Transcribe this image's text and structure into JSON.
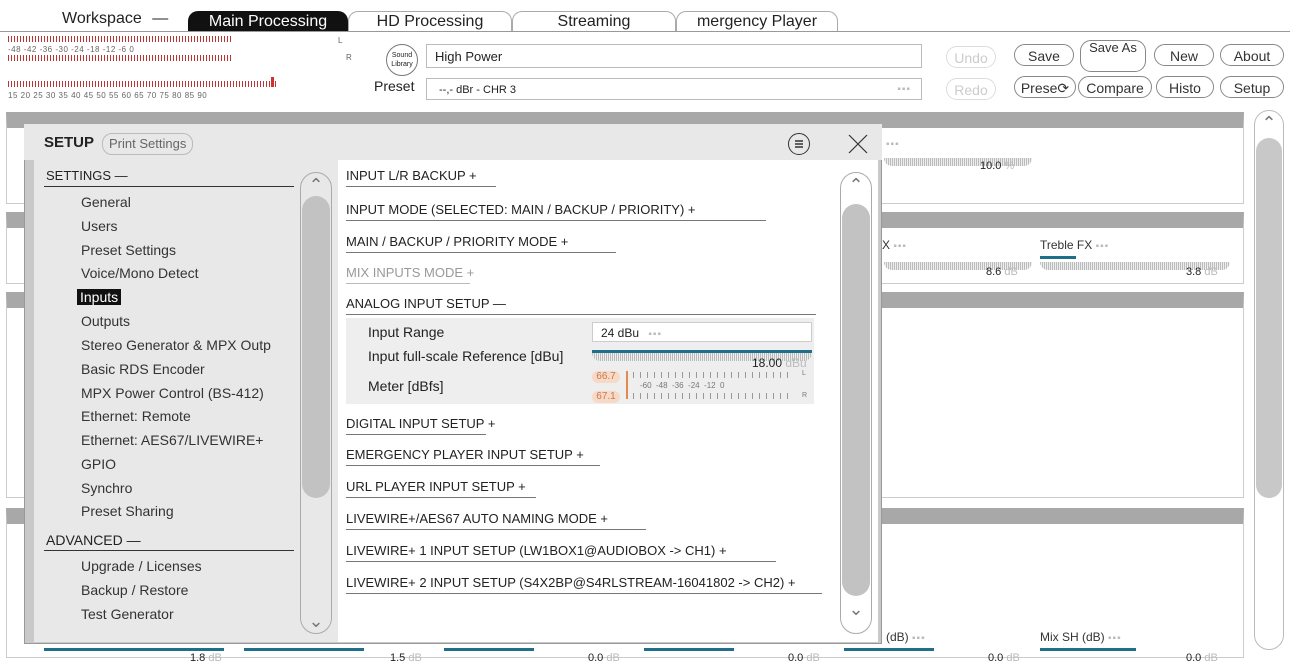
{
  "workspace": {
    "label": "Workspace"
  },
  "tabs": [
    {
      "label": "Main Processing"
    },
    {
      "label": "HD Processing"
    },
    {
      "label": "Streaming"
    },
    {
      "label": "mergency Player"
    }
  ],
  "meter": {
    "scale_top": "-48   -42   -36   -30   -24   -18    -12    -6     0",
    "l": "L",
    "r": "R",
    "scale_bottom": "15  20  25  30  35  40  45  50  55  60  65  70  75  80  85  90"
  },
  "sound_library": {
    "line1": "Sound",
    "line2": "Library"
  },
  "preset": {
    "name": "High Power",
    "label": "Preset",
    "chr": "--,- dBr - CHR 3",
    "dots": "▪▪▪"
  },
  "actions": {
    "undo": "Undo",
    "redo": "Redo",
    "save": "Save",
    "save_as": "Save As",
    "presets": "Prese⟳",
    "compare": "Compare",
    "new": "New",
    "history": "Histo",
    "about": "About",
    "setup": "Setup"
  },
  "background": {
    "knob1_value": "10.0",
    "knob1_unit": "%",
    "knob2_value": "8.6",
    "knob2_unit": "dB",
    "treble_label": "Treble FX",
    "treble_value": "3.8",
    "treble_unit": "dB",
    "db_label": "(dB)",
    "mix_sh_label": "Mix SH (dB)",
    "bottom_values": [
      "1.8",
      "1.5",
      "0.0",
      "0.0",
      "0.0",
      "0.0"
    ],
    "bottom_unit": "dB"
  },
  "dialog": {
    "title": "SETUP",
    "print_settings": "Print Settings",
    "settings_header": "SETTINGS —",
    "nav_items": [
      "General",
      "Users",
      "Preset Settings",
      "Voice/Mono Detect",
      "Inputs",
      "Outputs",
      "Stereo Generator & MPX Outp",
      "Basic RDS Encoder",
      "MPX Power Control (BS-412)",
      "Ethernet: Remote",
      "Ethernet: AES67/LIVEWIRE+",
      "GPIO",
      "Synchro",
      "Preset Sharing"
    ],
    "selected_item": "Inputs",
    "advanced_header": "ADVANCED —",
    "advanced_items": [
      "Upgrade / Licenses",
      "Backup / Restore",
      "Test Generator"
    ],
    "rows": [
      "INPUT L/R BACKUP  +",
      "INPUT MODE (SELECTED: MAIN / BACKUP / PRIORITY)  +",
      "MAIN / BACKUP / PRIORITY MODE  +",
      "MIX INPUTS MODE  +",
      "ANALOG INPUT SETUP  —",
      "DIGITAL INPUT SETUP  +",
      "EMERGENCY PLAYER INPUT SETUP  +",
      "URL PLAYER INPUT SETUP  +",
      "LIVEWIRE+/AES67 AUTO NAMING MODE  +",
      "LIVEWIRE+ 1 INPUT SETUP (LW1BOX1@AUDIOBOX -> CH1)  +",
      "LIVEWIRE+ 2 INPUT SETUP (S4X2BP@S4RLSTREAM-16041802 -> CH2)  +"
    ],
    "analog": {
      "input_range_label": "Input Range",
      "input_range_value": "24 dBu",
      "fullscale_label": "Input full-scale Reference [dBu]",
      "fullscale_value": "18.00",
      "fullscale_unit": "dBu",
      "meter_label": "Meter [dBfs]",
      "meter_l_value": "66.7",
      "meter_r_value": "67.1",
      "meter_scale": "-60  -48  -36  -24  -12  0"
    }
  },
  "colors": {
    "accent": "#1f6f8b",
    "dark": "#111111",
    "meter_red": "#cc3333"
  }
}
